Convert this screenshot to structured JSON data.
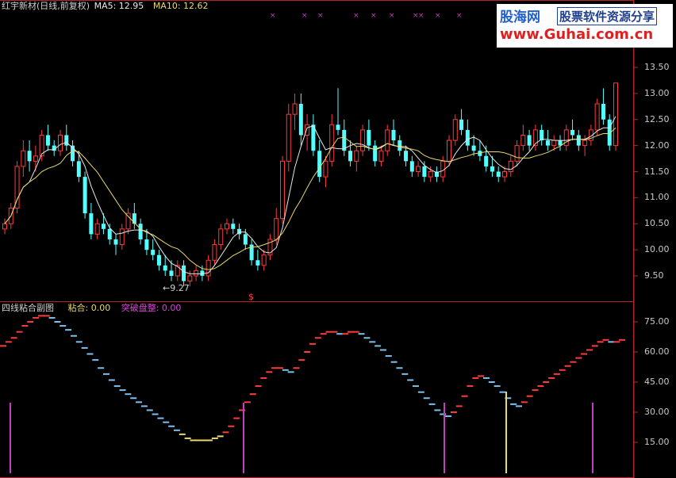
{
  "header": {
    "title": "红宇新材(日线,前复权)",
    "ma5_label": "MA5: 12.95",
    "ma10_label": "MA10: 12.62",
    "colors": {
      "title": "#d0d0d0",
      "ma5": "#e8e8e8",
      "ma10": "#e8d870"
    }
  },
  "sub_header": {
    "name": "四线粘合副图",
    "stick_label": "粘合: 0.00",
    "breakout_label": "突破盘整: 0.00",
    "colors": {
      "name": "#d0d0d0",
      "stick": "#e8d870",
      "breakout": "#e040e0"
    }
  },
  "annotations": {
    "low_label": "9.27",
    "dollar_marker": "$"
  },
  "watermark": {
    "logo": "股海网",
    "slogan": "股票软件资源分享",
    "url": "www.Guhai.com.cn"
  },
  "colors": {
    "up": "#ff3b3b",
    "down": "#54ffff",
    "border": "#b0252a",
    "bar": "#c040c0",
    "bar_yellow": "#e8d870",
    "axis_text": "#c8c8c8"
  },
  "chart_data": [
    {
      "type": "candlestick",
      "title": "红宇新材(日线,前复权)",
      "ylim": [
        9.2,
        14.0
      ],
      "yticks": [
        9.5,
        10.0,
        10.5,
        11.0,
        11.5,
        12.0,
        12.5,
        13.0,
        13.5
      ],
      "series": [
        {
          "name": "MA5",
          "last": 12.95
        },
        {
          "name": "MA10",
          "last": 12.62
        }
      ],
      "candles": [
        [
          10.4,
          10.6,
          10.3,
          10.5
        ],
        [
          10.5,
          10.9,
          10.4,
          10.8
        ],
        [
          10.8,
          11.7,
          10.7,
          11.6
        ],
        [
          11.6,
          12.1,
          11.4,
          11.9
        ],
        [
          11.9,
          12.1,
          11.5,
          11.7
        ],
        [
          11.7,
          12.0,
          11.5,
          11.8
        ],
        [
          11.8,
          12.3,
          11.7,
          12.2
        ],
        [
          12.2,
          12.4,
          11.9,
          12.0
        ],
        [
          12.0,
          12.1,
          11.8,
          11.9
        ],
        [
          11.9,
          12.3,
          11.8,
          12.2
        ],
        [
          12.2,
          12.4,
          11.9,
          12.0
        ],
        [
          12.0,
          12.1,
          11.6,
          11.7
        ],
        [
          11.7,
          11.9,
          11.3,
          11.4
        ],
        [
          11.4,
          11.5,
          10.6,
          10.7
        ],
        [
          10.7,
          10.9,
          10.2,
          10.3
        ],
        [
          10.3,
          10.6,
          10.2,
          10.5
        ],
        [
          10.5,
          10.7,
          10.3,
          10.4
        ],
        [
          10.4,
          10.5,
          10.1,
          10.2
        ],
        [
          10.2,
          10.3,
          9.9,
          10.1
        ],
        [
          10.1,
          10.5,
          10.0,
          10.4
        ],
        [
          10.4,
          10.8,
          10.3,
          10.7
        ],
        [
          10.7,
          10.9,
          10.4,
          10.5
        ],
        [
          10.5,
          10.6,
          10.1,
          10.2
        ],
        [
          10.2,
          10.4,
          9.9,
          10.0
        ],
        [
          10.0,
          10.2,
          9.8,
          9.9
        ],
        [
          9.9,
          10.0,
          9.6,
          9.7
        ],
        [
          9.7,
          9.9,
          9.5,
          9.6
        ],
        [
          9.6,
          9.8,
          9.4,
          9.5
        ],
        [
          9.5,
          9.8,
          9.4,
          9.7
        ],
        [
          9.7,
          9.8,
          9.3,
          9.4
        ],
        [
          9.4,
          9.6,
          9.3,
          9.5
        ],
        [
          9.5,
          9.7,
          9.4,
          9.6
        ],
        [
          9.6,
          9.7,
          9.4,
          9.5
        ],
        [
          9.5,
          9.9,
          9.4,
          9.8
        ],
        [
          9.8,
          10.2,
          9.7,
          10.1
        ],
        [
          10.1,
          10.5,
          10.0,
          10.4
        ],
        [
          10.4,
          10.6,
          10.3,
          10.5
        ],
        [
          10.5,
          10.6,
          10.3,
          10.4
        ],
        [
          10.4,
          10.5,
          10.2,
          10.3
        ],
        [
          10.3,
          10.4,
          10.0,
          10.1
        ],
        [
          10.1,
          10.2,
          9.7,
          9.8
        ],
        [
          9.8,
          10.0,
          9.6,
          9.7
        ],
        [
          9.7,
          10.0,
          9.6,
          9.9
        ],
        [
          9.9,
          10.3,
          9.8,
          10.2
        ],
        [
          10.2,
          10.8,
          10.1,
          10.6
        ],
        [
          10.6,
          11.8,
          10.5,
          11.7
        ],
        [
          11.7,
          12.8,
          11.5,
          12.6
        ],
        [
          12.6,
          13.0,
          12.3,
          12.8
        ],
        [
          12.8,
          13.0,
          12.0,
          12.2
        ],
        [
          12.2,
          12.6,
          11.9,
          12.4
        ],
        [
          12.4,
          12.6,
          11.8,
          11.9
        ],
        [
          11.9,
          12.1,
          11.3,
          11.4
        ],
        [
          11.4,
          11.8,
          11.2,
          11.7
        ],
        [
          11.7,
          12.6,
          11.6,
          12.4
        ],
        [
          12.4,
          13.1,
          12.2,
          12.3
        ],
        [
          12.3,
          12.5,
          11.8,
          11.9
        ],
        [
          11.9,
          12.1,
          11.6,
          11.7
        ],
        [
          11.7,
          12.0,
          11.5,
          11.9
        ],
        [
          11.9,
          12.4,
          11.8,
          12.3
        ],
        [
          12.3,
          12.5,
          11.9,
          12.0
        ],
        [
          12.0,
          12.1,
          11.6,
          11.7
        ],
        [
          11.7,
          12.0,
          11.6,
          11.9
        ],
        [
          11.9,
          12.4,
          11.8,
          12.3
        ],
        [
          12.3,
          12.5,
          12.0,
          12.1
        ],
        [
          12.1,
          12.2,
          11.8,
          11.9
        ],
        [
          11.9,
          12.0,
          11.6,
          11.7
        ],
        [
          11.7,
          11.8,
          11.4,
          11.5
        ],
        [
          11.5,
          11.7,
          11.4,
          11.6
        ],
        [
          11.6,
          11.7,
          11.3,
          11.4
        ],
        [
          11.4,
          11.6,
          11.3,
          11.5
        ],
        [
          11.5,
          11.6,
          11.3,
          11.4
        ],
        [
          11.4,
          11.8,
          11.3,
          11.7
        ],
        [
          11.7,
          12.2,
          11.6,
          12.1
        ],
        [
          12.1,
          12.6,
          12.0,
          12.5
        ],
        [
          12.5,
          12.7,
          12.2,
          12.3
        ],
        [
          12.3,
          12.5,
          11.9,
          12.0
        ],
        [
          12.0,
          12.2,
          11.8,
          11.9
        ],
        [
          11.9,
          12.1,
          11.7,
          11.8
        ],
        [
          11.8,
          12.0,
          11.5,
          11.6
        ],
        [
          11.6,
          11.8,
          11.4,
          11.5
        ],
        [
          11.5,
          11.6,
          11.3,
          11.4
        ],
        [
          11.4,
          11.6,
          11.3,
          11.5
        ],
        [
          11.5,
          11.8,
          11.4,
          11.7
        ],
        [
          11.7,
          12.1,
          11.6,
          12.0
        ],
        [
          12.0,
          12.4,
          11.9,
          12.2
        ],
        [
          12.2,
          12.3,
          11.9,
          12.0
        ],
        [
          12.0,
          12.4,
          11.9,
          12.3
        ],
        [
          12.3,
          12.4,
          12.0,
          12.1
        ],
        [
          12.1,
          12.3,
          11.9,
          12.0
        ],
        [
          12.0,
          12.2,
          11.9,
          12.1
        ],
        [
          12.1,
          12.2,
          11.9,
          12.0
        ],
        [
          12.0,
          12.4,
          11.9,
          12.3
        ],
        [
          12.3,
          12.5,
          12.1,
          12.2
        ],
        [
          12.2,
          12.3,
          11.9,
          12.0
        ],
        [
          12.0,
          12.2,
          11.8,
          12.1
        ],
        [
          12.1,
          12.4,
          12.0,
          12.3
        ],
        [
          12.3,
          12.9,
          12.2,
          12.8
        ],
        [
          12.8,
          13.1,
          12.4,
          12.5
        ],
        [
          12.5,
          12.6,
          11.9,
          12.0
        ],
        [
          12.0,
          13.2,
          11.9,
          13.2
        ]
      ],
      "annotations": [
        "9.27",
        "$"
      ]
    },
    {
      "type": "line",
      "title": "四线粘合副图",
      "ylim": [
        5,
        82
      ],
      "yticks": [
        15.0,
        30.0,
        45.0,
        60.0,
        75.0
      ],
      "series": [
        {
          "name": "粘合",
          "last": 0.0
        },
        {
          "name": "突破盘整",
          "last": 0.0
        }
      ],
      "oscillator": [
        63,
        65,
        67,
        70,
        73,
        75,
        77,
        78,
        78,
        77,
        75,
        73,
        71,
        68,
        65,
        62,
        59,
        56,
        52,
        49,
        46,
        43,
        41,
        39,
        37,
        35,
        33,
        31,
        29,
        27,
        25,
        23,
        21,
        19,
        17,
        16,
        16,
        16,
        16,
        17,
        18,
        20,
        23,
        27,
        31,
        35,
        39,
        43,
        47,
        50,
        52,
        52,
        51,
        50,
        52,
        56,
        60,
        64,
        67,
        69,
        70,
        70,
        69,
        69,
        70,
        70,
        69,
        67,
        65,
        63,
        61,
        58,
        55,
        52,
        49,
        46,
        43,
        40,
        37,
        34,
        31,
        29,
        28,
        30,
        33,
        38,
        43,
        47,
        48,
        47,
        45,
        43,
        40,
        37,
        34,
        33,
        35,
        38,
        41,
        43,
        45,
        47,
        49,
        51,
        53,
        55,
        57,
        59,
        61,
        63,
        65,
        66,
        65,
        65,
        66
      ]
    }
  ]
}
